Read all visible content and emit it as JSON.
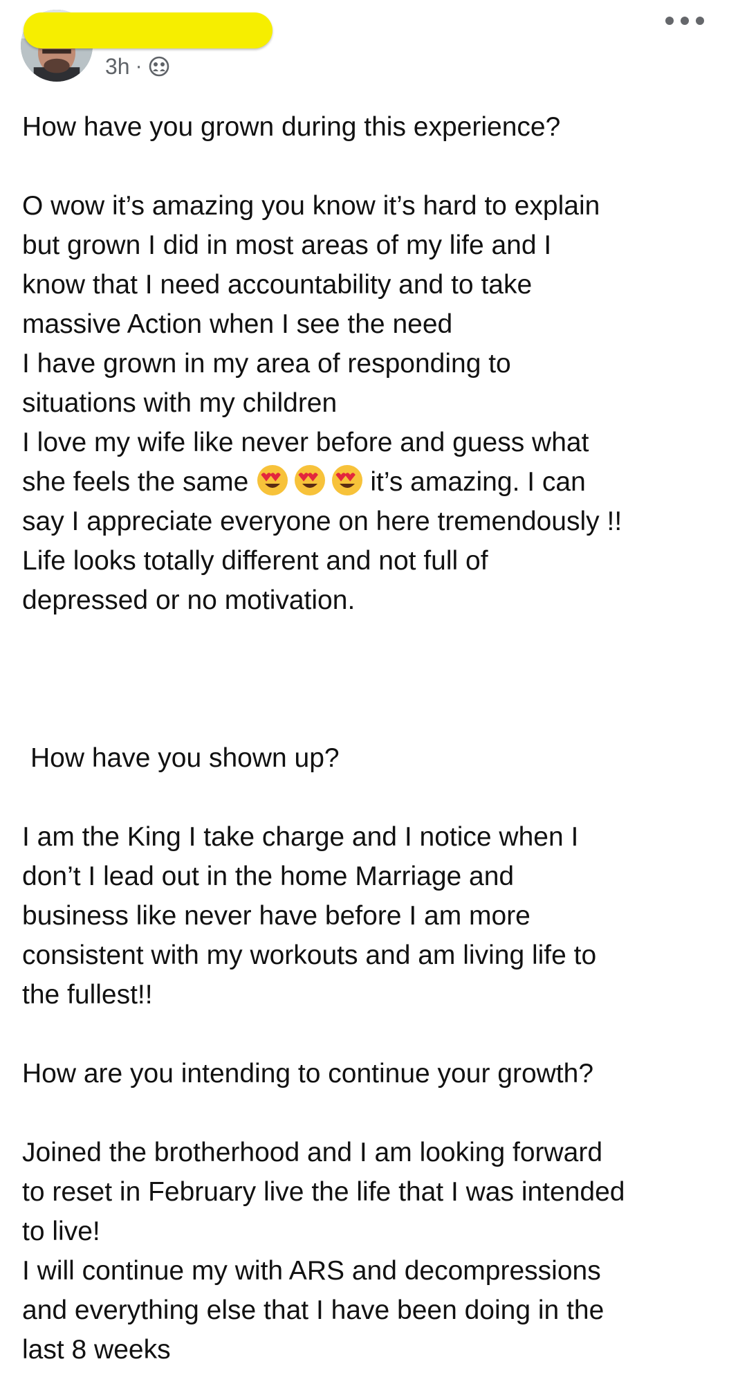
{
  "header": {
    "time": "3h",
    "separator": "·",
    "audience_icon": "group-icon",
    "redaction_color": "#f6ee00"
  },
  "post": {
    "q1": "How have you grown during this experience?",
    "a1_lines": [
      "O wow it’s amazing you know it’s hard to explain",
      "but grown I did in most areas of my life and I",
      "know that I need accountability and to take",
      "massive Action when I see the need",
      "I have grown in my area of responding to",
      "situations with my children",
      "I love my wife like never before and guess what"
    ],
    "a1_emoji_before": "she feels the same",
    "a1_emoji_after": "it’s amazing. I can",
    "a1_emoji_names": [
      "heart-eyes-emoji",
      "heart-eyes-emoji",
      "heart-eyes-emoji"
    ],
    "a1_lines_end": [
      "say I appreciate everyone on here tremendously !!",
      "Life looks totally different and not full of",
      "depressed or no motivation."
    ],
    "q2": "How have you shown up?",
    "a2_lines": [
      "I am the King I take charge and I notice when I",
      "don’t I lead out in the home Marriage and",
      "business like never have before I am more",
      "consistent with my workouts and am living life to",
      "the fullest!!"
    ],
    "q3": "How are you intending to continue your growth?",
    "a3_lines": [
      "Joined the brotherhood and I am looking forward",
      "to reset in February live the life that I was intended",
      "to live!",
      "I will continue my with ARS and decompressions",
      "and everything else that I have been doing in the",
      "last 8 weeks"
    ]
  }
}
